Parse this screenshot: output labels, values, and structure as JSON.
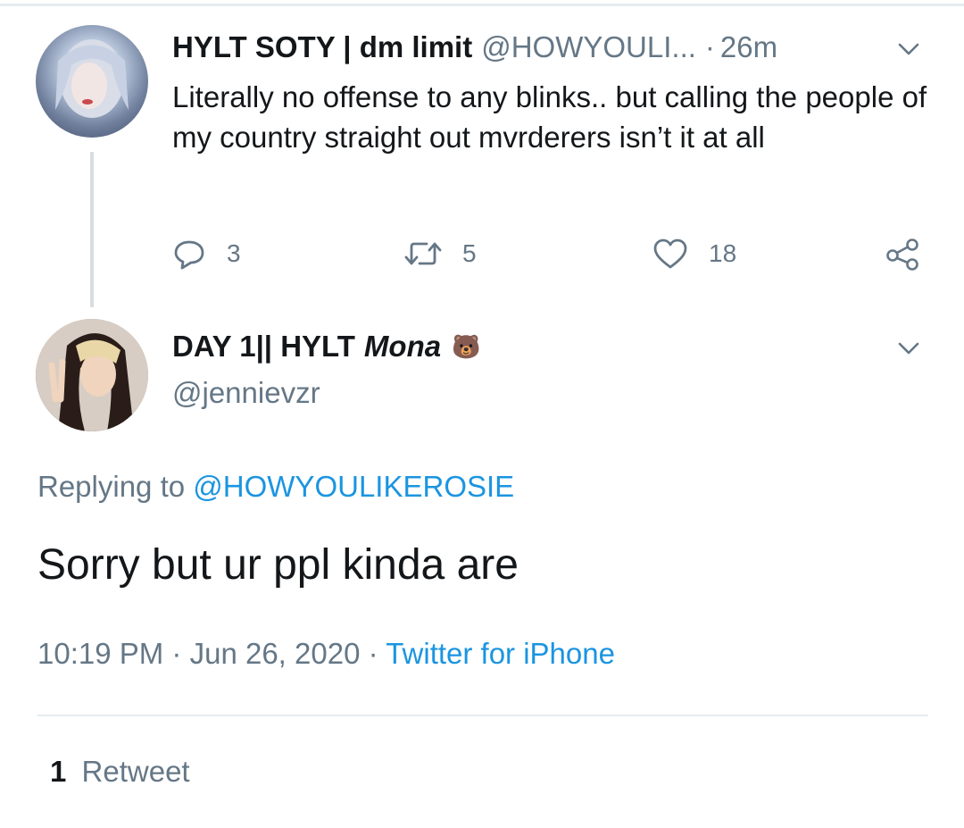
{
  "tweet1": {
    "display_name": "HYLT SOTY | dm limit",
    "handle": "@HOWYOULI...",
    "separator": "·",
    "time": "26m",
    "text": "Literally no offense to any blinks.. but calling the people of my country straight out mvrderers isn’t it at all",
    "reply_count": "3",
    "retweet_count": "5",
    "like_count": "18",
    "icons": [
      "chevron-down-icon",
      "reply-icon",
      "retweet-icon",
      "heart-icon",
      "share-icon"
    ]
  },
  "tweet2": {
    "display_name_prefix": "DAY 1|| HYLT",
    "display_name_italic": "Mona",
    "name_emoji": "🐻",
    "handle": "@jennievzr",
    "replying_prefix": "Replying to",
    "replying_to": "@HOWYOULIKEROSIE",
    "text": "Sorry but ur ppl kinda are",
    "time": "10:19 PM",
    "dot1": "·",
    "date": "Jun 26, 2020",
    "dot2": "·",
    "source": "Twitter for iPhone",
    "retweets_count": "1",
    "retweets_label": "Retweet"
  },
  "colors": {
    "text": "#14171a",
    "muted": "#657786",
    "link": "#1b95e0",
    "divider": "#e6ecf0"
  }
}
